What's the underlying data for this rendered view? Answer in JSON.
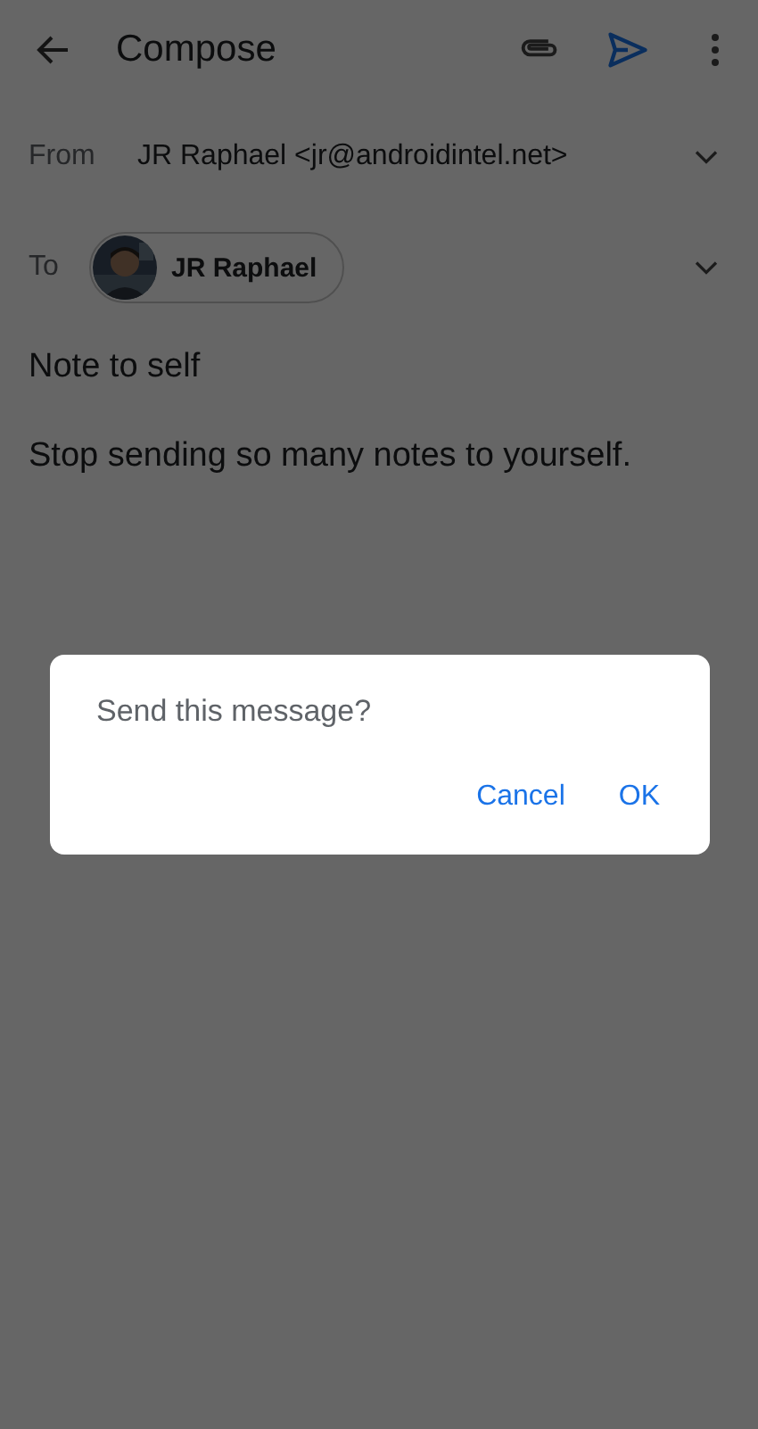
{
  "app_bar": {
    "title": "Compose"
  },
  "from": {
    "label": "From",
    "value": "JR Raphael <jr@androidintel.net>"
  },
  "to": {
    "label": "To",
    "recipients": [
      {
        "name": "JR Raphael"
      }
    ]
  },
  "subject": "Note to self",
  "body": "Stop sending so many notes to yourself.",
  "dialog": {
    "message": "Send this message?",
    "buttons": [
      "Cancel",
      "OK"
    ]
  }
}
